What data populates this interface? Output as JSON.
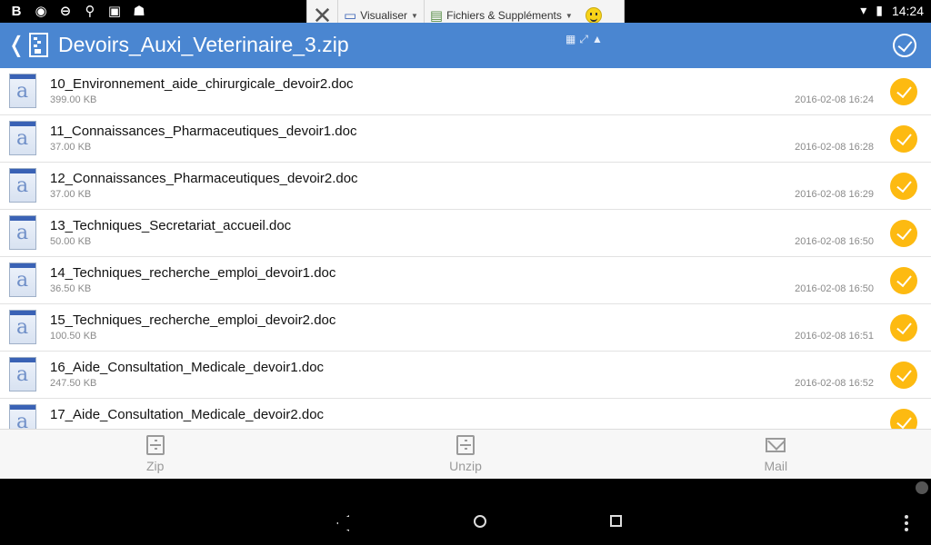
{
  "status": {
    "time": "14:24",
    "left_icons": [
      "blogger-icon",
      "eye-icon",
      "vpn-icon",
      "usb-icon",
      "briefcase-icon",
      "android-icon"
    ]
  },
  "floatbar": {
    "view_label": "Visualiser",
    "files_label": "Fichiers & Suppléments"
  },
  "appbar": {
    "title": "Devoirs_Auxi_Veterinaire_3.zip"
  },
  "files": [
    {
      "name": "10_Environnement_aide_chirurgicale_devoir2.doc",
      "size": "399.00 KB",
      "date": "2016-02-08 16:24"
    },
    {
      "name": "11_Connaissances_Pharmaceutiques_devoir1.doc",
      "size": "37.00 KB",
      "date": "2016-02-08 16:28"
    },
    {
      "name": "12_Connaissances_Pharmaceutiques_devoir2.doc",
      "size": "37.00 KB",
      "date": "2016-02-08 16:29"
    },
    {
      "name": "13_Techniques_Secretariat_accueil.doc",
      "size": "50.00 KB",
      "date": "2016-02-08 16:50"
    },
    {
      "name": "14_Techniques_recherche_emploi_devoir1.doc",
      "size": "36.50 KB",
      "date": "2016-02-08 16:50"
    },
    {
      "name": "15_Techniques_recherche_emploi_devoir2.doc",
      "size": "100.50 KB",
      "date": "2016-02-08 16:51"
    },
    {
      "name": "16_Aide_Consultation_Medicale_devoir1.doc",
      "size": "247.50 KB",
      "date": "2016-02-08 16:52"
    },
    {
      "name": "17_Aide_Consultation_Medicale_devoir2.doc",
      "size": "",
      "date": ""
    }
  ],
  "bottombar": {
    "zip": "Zip",
    "unzip": "Unzip",
    "mail": "Mail"
  },
  "colors": {
    "appbar": "#4a86d1",
    "check": "#fdba11"
  }
}
